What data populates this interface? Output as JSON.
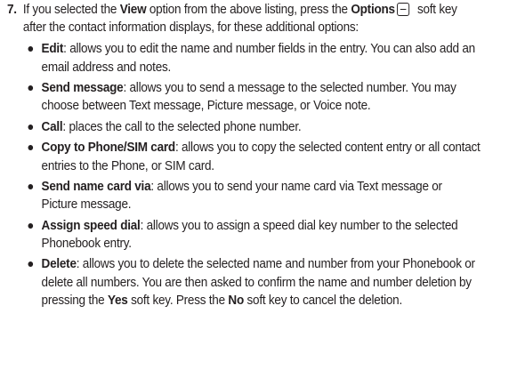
{
  "step": {
    "number": "7.",
    "intro_1": "If you selected the ",
    "intro_view": "View",
    "intro_2": " option from the above listing, press the ",
    "intro_options": "Options",
    "softkey_icon": "minus-softkey-icon",
    "intro_3": " soft key after the contact information displays, for these additional options:"
  },
  "options": [
    {
      "term": "Edit",
      "text": ": allows you to edit the name and number fields in the entry. You can also add an email address and notes."
    },
    {
      "term": "Send message",
      "text": ": allows you to send a message to the selected number. You may choose between Text message, Picture message, or Voice note."
    },
    {
      "term": "Call",
      "text": ": places the call to the selected phone number."
    },
    {
      "term": "Copy to Phone/SIM card",
      "text": ": allows you to copy the selected content entry or all contact entries to the Phone, or SIM card."
    },
    {
      "term": "Send name card via",
      "text": ": allows you to send your name card via Text message or Picture message."
    },
    {
      "term": "Assign speed dial",
      "text": ": allows you to assign a speed dial key number to the selected Phonebook entry."
    },
    {
      "term": "Delete",
      "text_1": ": allows you to delete the selected name and number from your Phonebook or delete all numbers. You are then asked to confirm the name and number deletion by pressing the ",
      "yes": "Yes",
      "text_2": " soft key. Press the ",
      "no": "No",
      "text_3": " soft key to cancel the deletion."
    }
  ]
}
